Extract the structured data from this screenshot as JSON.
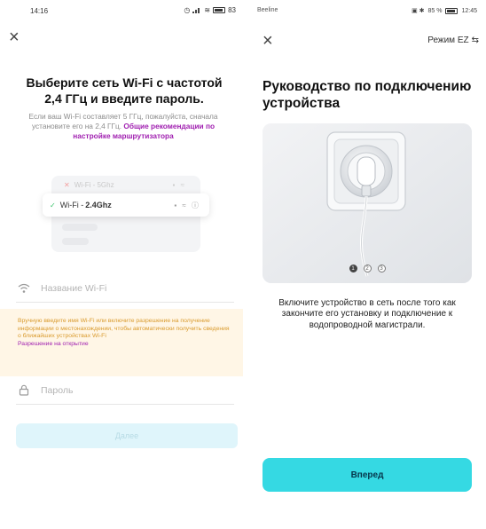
{
  "left": {
    "status": {
      "time": "14:16",
      "battery": "83"
    },
    "title": "Выберите сеть Wi-Fi с частотой 2,4 ГГц и введите пароль.",
    "description": "Если ваш Wi-Fi составляет 5 ГГц, пожалуйста, сначала установите его на 2,4 ГГц.",
    "description_link": "Общие рекомендации по настройке маршрутизатора",
    "wifi_examples": {
      "bad": {
        "mark": "✕",
        "label": "Wi-Fi - 5Ghz"
      },
      "good": {
        "mark": "✓",
        "label_prefix": "Wi-Fi - ",
        "label_band": "2.4Ghz"
      }
    },
    "wifi_name_placeholder": "Название Wi-Fi",
    "notice_text": "Вручную введите имя Wi-Fi или включите разрешение на получение информации о местонахождении, чтобы автоматически получить сведения о ближайших устройствах Wi-Fi",
    "notice_link": "Разрешение на открытие",
    "password_placeholder": "Пароль",
    "next_button": "Далее"
  },
  "right": {
    "status": {
      "carrier": "Beeline",
      "battery": "85 %",
      "time": "12:45"
    },
    "ez_mode": "Режим EZ",
    "title": "Руководство по подключению устройства",
    "pager": [
      "1",
      "2",
      "3"
    ],
    "pager_active": 0,
    "description": "Включите устройство в сеть после того как закончите его установку и подключение к водопроводной магистрали.",
    "forward_button": "Вперед"
  },
  "colors": {
    "accent_cyan": "#35d9e3",
    "link_purple": "#a01fb0",
    "notice_bg": "#fff6e6",
    "notice_text": "#d99a2c",
    "disabled_btn": "#dff5fb"
  }
}
